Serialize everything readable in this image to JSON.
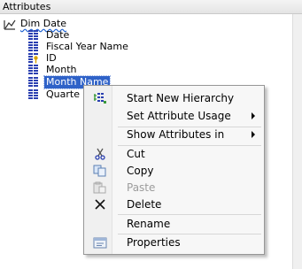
{
  "panel": {
    "title": "Attributes"
  },
  "tree": {
    "root": {
      "label": "Dim Date"
    },
    "items": [
      {
        "label": "Date",
        "icon": "attribute-icon"
      },
      {
        "label": "Fiscal Year Name",
        "icon": "attribute-icon"
      },
      {
        "label": "ID",
        "icon": "key-attribute-icon"
      },
      {
        "label": "Month",
        "icon": "attribute-icon"
      },
      {
        "label": "Month Name",
        "icon": "attribute-icon",
        "selected": true
      },
      {
        "label": "Quarte",
        "icon": "attribute-icon"
      }
    ]
  },
  "context_menu": {
    "items": [
      {
        "label": "Start New Hierarchy",
        "icon": "hierarchy-icon"
      },
      {
        "label": "Set Attribute Usage",
        "submenu": true
      },
      {
        "label": "Show Attributes in",
        "submenu": true
      },
      {
        "label": "Cut",
        "icon": "scissors-icon"
      },
      {
        "label": "Copy",
        "icon": "copy-icon"
      },
      {
        "label": "Paste",
        "icon": "paste-icon",
        "disabled": true
      },
      {
        "label": "Delete",
        "icon": "delete-x-icon"
      },
      {
        "label": "Rename"
      },
      {
        "label": "Properties",
        "icon": "properties-icon"
      }
    ]
  },
  "colors": {
    "selection": "#2f62c8",
    "attribute_icon": "#2a3fb0",
    "key_icon": "#d7a400"
  }
}
